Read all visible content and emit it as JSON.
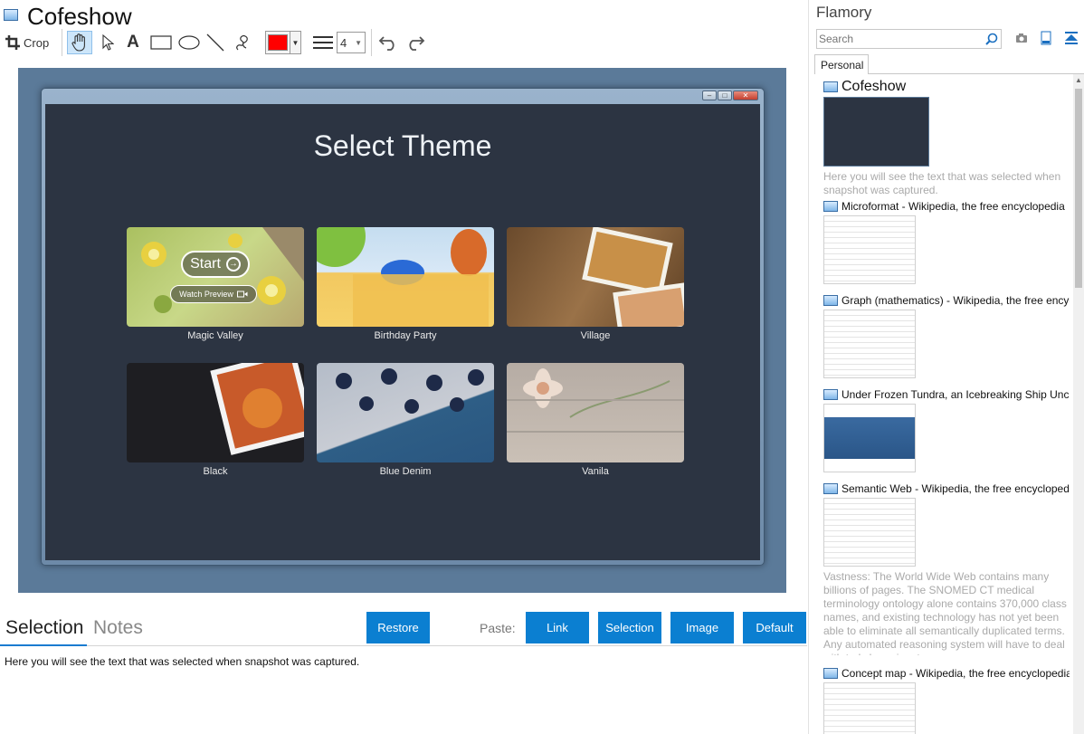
{
  "app": {
    "title": "Cofeshow"
  },
  "toolbar": {
    "crop_label": "Crop",
    "text_tool_glyph": "A",
    "stroke_color": "#ff0000",
    "line_width": "4"
  },
  "snapshot": {
    "heading": "Select Theme",
    "start_label": "Start",
    "watch_preview_label": "Watch Preview",
    "themes": [
      {
        "label": "Magic Valley"
      },
      {
        "label": "Birthday Party"
      },
      {
        "label": "Village"
      },
      {
        "label": "Black"
      },
      {
        "label": "Blue Denim"
      },
      {
        "label": "Vanila"
      }
    ]
  },
  "bottom": {
    "tab_selection": "Selection",
    "tab_notes": "Notes",
    "restore_label": "Restore",
    "paste_label": "Paste:",
    "paste_buttons": [
      "Link",
      "Selection",
      "Image",
      "Default"
    ],
    "selection_text": "Here you will see the text that was selected when snapshot was captured."
  },
  "panel": {
    "title": "Flamory",
    "search_placeholder": "Search",
    "tab_personal": "Personal",
    "items": [
      {
        "title": "Cofeshow",
        "desc": "Here you will see the text that was selected when snapshot was captured."
      },
      {
        "title": "Microformat - Wikipedia, the free encyclopedia"
      },
      {
        "title": "Graph (mathematics) - Wikipedia, the free encyclopedia"
      },
      {
        "title": "Under Frozen Tundra, an Icebreaking Ship Uncovers"
      },
      {
        "title": "Semantic Web - Wikipedia, the free encyclopedia",
        "desc": "Vastness: The World Wide Web contains many billions of pages. The SNOMED CT medical terminology ontology alone contains 370,000 class names, and existing technology has not yet been able to eliminate all semantically duplicated terms. Any automated reasoning system will have to deal with truly huge inputs."
      },
      {
        "title": "Concept map - Wikipedia, the free encyclopedia"
      }
    ]
  }
}
